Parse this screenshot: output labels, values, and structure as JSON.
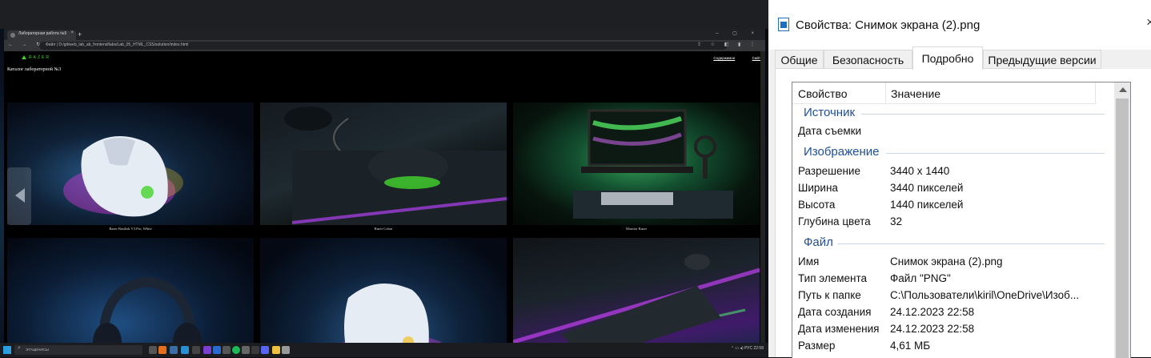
{
  "browser": {
    "tab_title": "Лабораторная работа №5",
    "tab_close": "×",
    "new_tab": "+",
    "window_controls": "– ▢ ×",
    "nav_buttons": "← → ↻",
    "url": "Файл | D:/git/web_lab_ab_frontend/labs/Lab_05_HTML_CSS/solution/index.html",
    "addr_icons": "⇪ ☆ ◧ ▮ ⋮"
  },
  "site": {
    "logo": "RAZER",
    "links": [
      "Содержимое",
      "Сайт"
    ],
    "catalog_title": "Каталог лабораторной №3",
    "products": [
      {
        "caption": "Razer Basilisk V3 Pro, White"
      },
      {
        "caption": "Razer Cobra"
      },
      {
        "caption": "Monitor Razer"
      }
    ]
  },
  "taskbar": {
    "search_label": "ЭТАЦЕНИСЫ",
    "tray_text": "⌃  ▭  ◂)  РУС  22:58"
  },
  "properties": {
    "title": "Свойства: Снимок экрана (2).png",
    "close": "×",
    "tabs": [
      "Общие",
      "Безопасность",
      "Подробно",
      "Предыдущие версии"
    ],
    "header_property": "Свойство",
    "header_value": "Значение",
    "groups": {
      "source": "Источник",
      "image": "Изображение",
      "file": "Файл"
    },
    "rows": {
      "date_taken": {
        "name": "Дата съемки",
        "value": ""
      },
      "resolution": {
        "name": "Разрешение",
        "value": "3440 x 1440"
      },
      "width": {
        "name": "Ширина",
        "value": "3440 пикселей"
      },
      "height": {
        "name": "Высота",
        "value": "1440 пикселей"
      },
      "bit_depth": {
        "name": "Глубина цвета",
        "value": "32"
      },
      "name": {
        "name": "Имя",
        "value": "Снимок экрана (2).png"
      },
      "type": {
        "name": "Тип элемента",
        "value": "Файл \"PNG\""
      },
      "path": {
        "name": "Путь к папке",
        "value": "C:\\Пользователи\\kiril\\OneDrive\\Изоб..."
      },
      "created": {
        "name": "Дата создания",
        "value": "24.12.2023 22:58"
      },
      "modified": {
        "name": "Дата изменения",
        "value": "24.12.2023 22:58"
      },
      "size": {
        "name": "Размер",
        "value": "4,61 МБ"
      }
    }
  },
  "colors": {
    "razer_green": "#44d62c",
    "group_blue": "#1e4e9b"
  }
}
